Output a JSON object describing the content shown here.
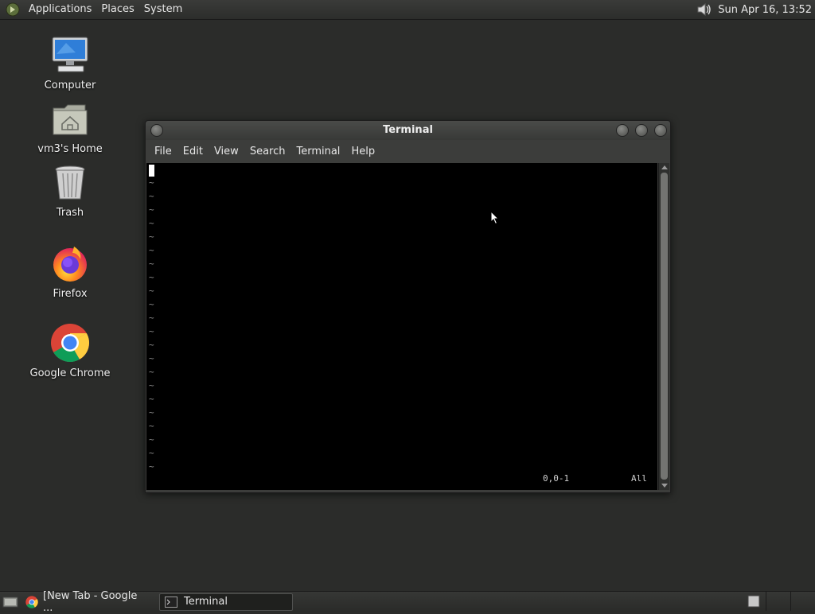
{
  "top_panel": {
    "menus": [
      "Applications",
      "Places",
      "System"
    ],
    "clock": "Sun Apr 16, 13:52",
    "volume_icon": "speaker-icon"
  },
  "desktop": {
    "icons": [
      {
        "label": "Computer",
        "icon": "computer-icon"
      },
      {
        "label": "vm3's Home",
        "icon": "home-folder-icon"
      },
      {
        "label": "Trash",
        "icon": "trash-icon"
      },
      {
        "label": "Firefox",
        "icon": "firefox-icon"
      },
      {
        "label": "Google Chrome",
        "icon": "chrome-icon"
      }
    ]
  },
  "terminal": {
    "title": "Terminal",
    "menu": [
      "File",
      "Edit",
      "View",
      "Search",
      "Terminal",
      "Help"
    ],
    "tilde": "~",
    "status_position": "0,0-1",
    "status_scope": "All"
  },
  "taskbar": {
    "tasks": [
      {
        "label": "[New Tab - Google ...",
        "icon": "chrome-icon"
      },
      {
        "label": "Terminal",
        "icon": "terminal-icon"
      }
    ]
  },
  "colors": {
    "desktop_bg": "#2b2c2a",
    "terminal_bg": "#000000",
    "panel_bg": "#333432"
  }
}
